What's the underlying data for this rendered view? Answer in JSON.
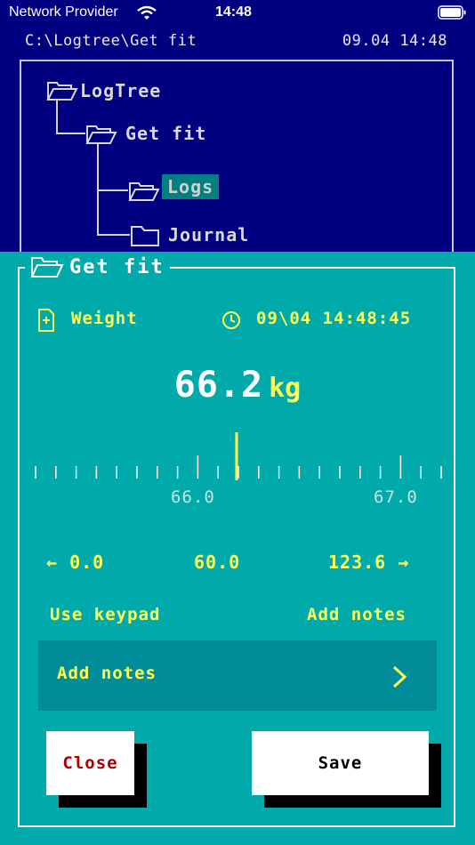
{
  "status_bar": {
    "carrier": "Network Provider",
    "time": "14:48"
  },
  "path_bar": {
    "path": "C:\\Logtree\\Get fit",
    "datetime": "09.04 14:48"
  },
  "tree": {
    "nodes": [
      {
        "label": "LogTree",
        "icon": "folder-open-icon"
      },
      {
        "label": "Get fit",
        "icon": "folder-open-icon"
      },
      {
        "label": "Logs",
        "icon": "folder-open-icon",
        "selected": true
      },
      {
        "label": "Journal",
        "icon": "folder-icon"
      }
    ]
  },
  "dialog": {
    "title": "Get fit",
    "entry_label": "Weight",
    "timestamp": "09\\04 14:48:45",
    "value": "66.2",
    "unit": "kg",
    "ruler": {
      "label_a": "66.0",
      "label_b": "67.0"
    },
    "range": {
      "min": "← 0.0",
      "mid": "60.0",
      "max": "123.6 →"
    },
    "use_keypad": "Use keypad",
    "add_notes_link": "Add notes",
    "notes_row_label": "Add notes",
    "close_button": "Close",
    "save_button": "Save"
  },
  "colors": {
    "background": "#000080",
    "dialog": "#00aaaa",
    "accent_yellow": "#ffff55",
    "notes_row": "#008c99",
    "selected_node": "#008080",
    "close_text": "#aa0000"
  }
}
